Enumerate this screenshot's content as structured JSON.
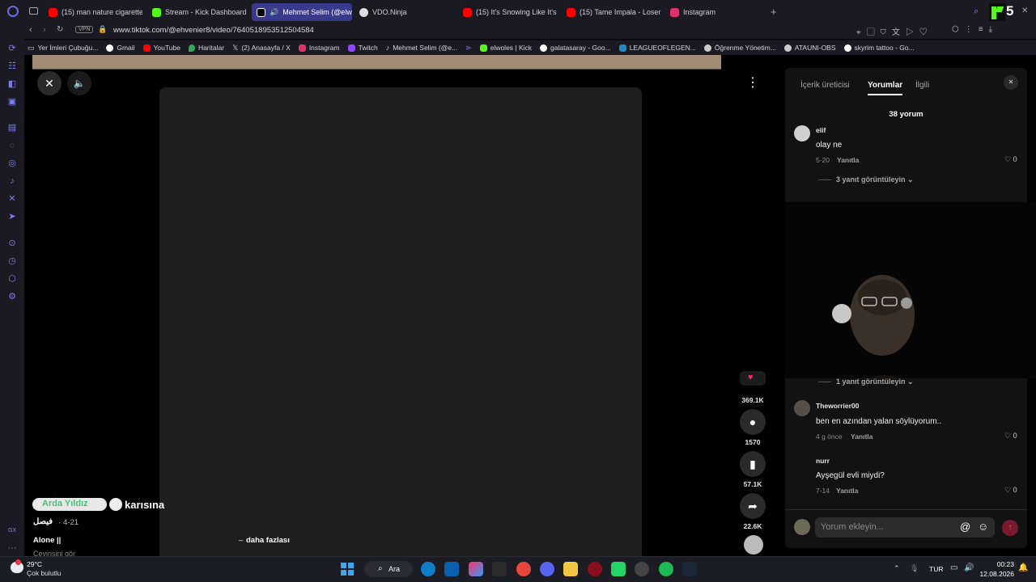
{
  "browser": {
    "tabs": [
      {
        "label": "(15) man nature cigarette s",
        "favicon_color": "#ff0000"
      },
      {
        "label": "Stream - Kick Dashboard",
        "favicon_color": "#53fc18"
      },
      {
        "label": "Mehmet Selim (@elwol",
        "favicon_color": "#ffffff",
        "active": true
      },
      {
        "label": "VDO.Ninja",
        "favicon_color": "#dddddd"
      },
      {
        "label": "(15) It's Snowing Like It's t",
        "favicon_color": "#ff0000"
      },
      {
        "label": "(15) Tame Impala - Loser (",
        "favicon_color": "#ff0000"
      },
      {
        "label": "Instagram",
        "favicon_color": "#e1306c"
      }
    ],
    "new_tab_symbol": "+",
    "vpn_label": "VPN",
    "url": "www.tiktok.com/@ehvenier8/video/7640518953512504584",
    "kick_badge": "5",
    "bookmarks": [
      {
        "label": "Yer İmleri Çubuğu...",
        "icon": "folder-icon"
      },
      {
        "label": "Gmail",
        "icon": "google-icon"
      },
      {
        "label": "YouTube",
        "icon": "youtube-icon"
      },
      {
        "label": "Haritalar",
        "icon": "maps-icon"
      },
      {
        "label": "(2) Anasayfa / X",
        "icon": "x-icon"
      },
      {
        "label": "Instagram",
        "icon": "instagram-icon"
      },
      {
        "label": "Twitch",
        "icon": "twitch-icon"
      },
      {
        "label": "Mehmet Selim (@e...",
        "icon": "tiktok-icon"
      },
      {
        "label": "",
        "icon": "vdo-icon"
      },
      {
        "label": "elwoles | Kick",
        "icon": "kick-icon"
      },
      {
        "label": "galatasaray - Goo...",
        "icon": "google-icon"
      },
      {
        "label": "LEAGUEOFLEGEN...",
        "icon": "league-icon"
      },
      {
        "label": "Öğrenme Yönetim...",
        "icon": "lms-icon"
      },
      {
        "label": "ATAUNI-OBS",
        "icon": "obs-icon"
      },
      {
        "label": "skyrim tattoo - Go...",
        "icon": "google-icon"
      }
    ]
  },
  "video": {
    "caption_author": "فيصل",
    "caption_date": "4-21",
    "caption_title": "karısına",
    "caption_overlay": "Arda Yıldız",
    "caption_desc": "Alone ||",
    "more_label": "daha fazlası",
    "translate_label": "Çevirisini gör",
    "actions": {
      "likes": "369.1K",
      "comments": "1570",
      "saves": "57.1K",
      "shares": "22.6K"
    }
  },
  "comments_panel": {
    "tabs": [
      "İçerik üreticisi",
      "Yorumlar",
      "İlgili"
    ],
    "active_tab": "Yorumlar",
    "count_label": "38 yorum",
    "comments": [
      {
        "user": "elif",
        "text": "olay ne",
        "date": "5-20",
        "reply": "Yanıtla",
        "likes": "0",
        "avatar_color": "#d0d0d0",
        "view_replies": "3 yanıt görüntüleyin"
      },
      {
        "user": "Theworrier00",
        "text": "ben en azından yalan söylüyorum..",
        "date": "4 g önce",
        "reply": "Yanıtla",
        "likes": "0",
        "avatar_color": "#555045"
      },
      {
        "user": "nurr",
        "text": "Ayşegül evli miydi?",
        "date": "7-14",
        "reply": "Yanıtla",
        "likes": "0",
        "avatar_color": "#111111"
      }
    ],
    "hidden_replies_label": "1 yanıt görüntüleyin",
    "input_placeholder": "Yorum ekleyin...",
    "send_color": "#fe2c55"
  },
  "taskbar": {
    "weather_temp": "29°C",
    "weather_desc": "Çok bulutlu",
    "search_label": "Ara",
    "language": "TUR",
    "time": "00:23",
    "date": "12.08.2026"
  },
  "colors": {
    "accent_tab": "#3a3a8c",
    "panel_bg": "#121212",
    "kick_green": "#53fc18"
  }
}
